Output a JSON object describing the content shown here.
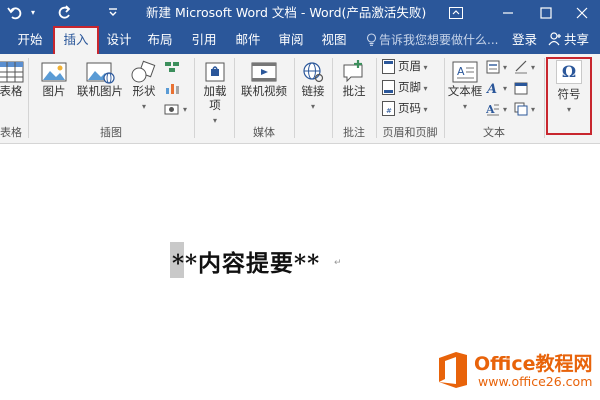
{
  "window": {
    "title": "新建 Microsoft Word 文档 - Word(产品激活失败)",
    "accent": "#2b579a"
  },
  "quick_access": {
    "undo_icon": "undo-icon",
    "redo_icon": "redo-icon",
    "customize_icon": "chevron-down-icon"
  },
  "tabs": [
    {
      "label": "开始"
    },
    {
      "label": "插入",
      "active": true
    },
    {
      "label": "设计"
    },
    {
      "label": "布局"
    },
    {
      "label": "引用"
    },
    {
      "label": "邮件"
    },
    {
      "label": "审阅"
    },
    {
      "label": "视图"
    }
  ],
  "tell_me": "告诉我您想要做什么...",
  "account": {
    "login": "登录",
    "share": "共享"
  },
  "ribbon": {
    "table": {
      "label": "表格",
      "group": "表格"
    },
    "illustrations": {
      "group": "插图",
      "picture": "图片",
      "online_picture": "联机图片",
      "shapes": "形状"
    },
    "addins": {
      "label": "加载项",
      "label_line1": "加载",
      "label_line2": "项"
    },
    "media": {
      "online_video": "联机视频",
      "group": "媒体"
    },
    "links": {
      "label": "链接"
    },
    "comments": {
      "comment": "批注",
      "group": "批注"
    },
    "header_footer": {
      "header": "页眉",
      "footer": "页脚",
      "page_number": "页码",
      "group": "页眉和页脚"
    },
    "text": {
      "textbox": "文本框",
      "group": "文本"
    },
    "symbols": {
      "symbol": "符号",
      "glyph": "Ω"
    }
  },
  "document": {
    "text": "**内容提要**"
  },
  "watermark": {
    "brand": "Office教程网",
    "url": "www.office26.com",
    "color": "#e8630a"
  }
}
